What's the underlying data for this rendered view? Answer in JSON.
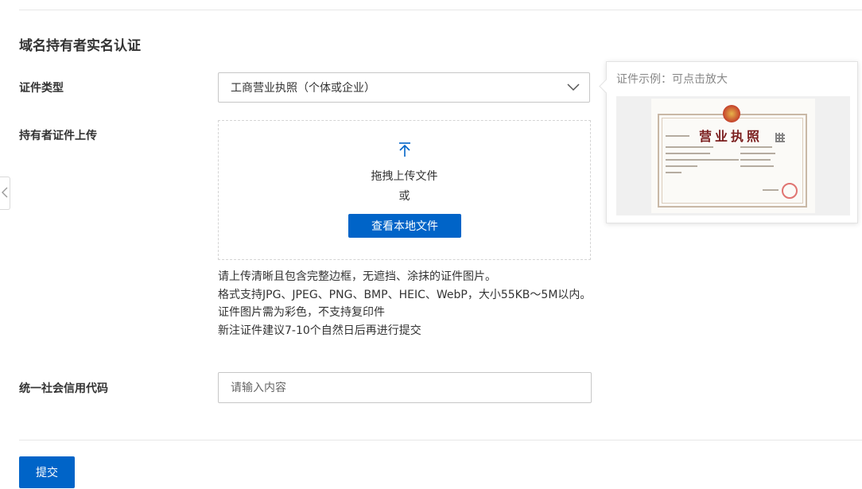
{
  "section": {
    "title": "域名持有者实名认证"
  },
  "cert_type": {
    "label": "证件类型",
    "selected_value": "工商营业执照（个体或企业）"
  },
  "upload": {
    "label": "持有者证件上传",
    "drag_text": "拖拽上传文件",
    "or_text": "或",
    "browse_label": "查看本地文件",
    "hints": [
      "请上传清晰且包含完整边框，无遮挡、涂抹的证件图片。",
      "格式支持JPG、JPEG、PNG、BMP、HEIC、WebP，大小55KB～5M以内。",
      "证件图片需为彩色，不支持复印件",
      "新注证件建议7-10个自然日后再进行提交"
    ]
  },
  "credit_code": {
    "label": "统一社会信用代码",
    "placeholder": "请输入内容"
  },
  "example": {
    "title": "证件示例：可点击放大",
    "license_title": "营业执照"
  },
  "actions": {
    "submit_label": "提交"
  },
  "icons": {
    "select_arrow": "chevron-down-icon",
    "upload": "upload-arrow-icon",
    "collapse": "chevron-left-icon"
  },
  "colors": {
    "primary": "#0064c8",
    "border": "#c7c7c7",
    "text": "#333333",
    "muted": "#888888"
  }
}
